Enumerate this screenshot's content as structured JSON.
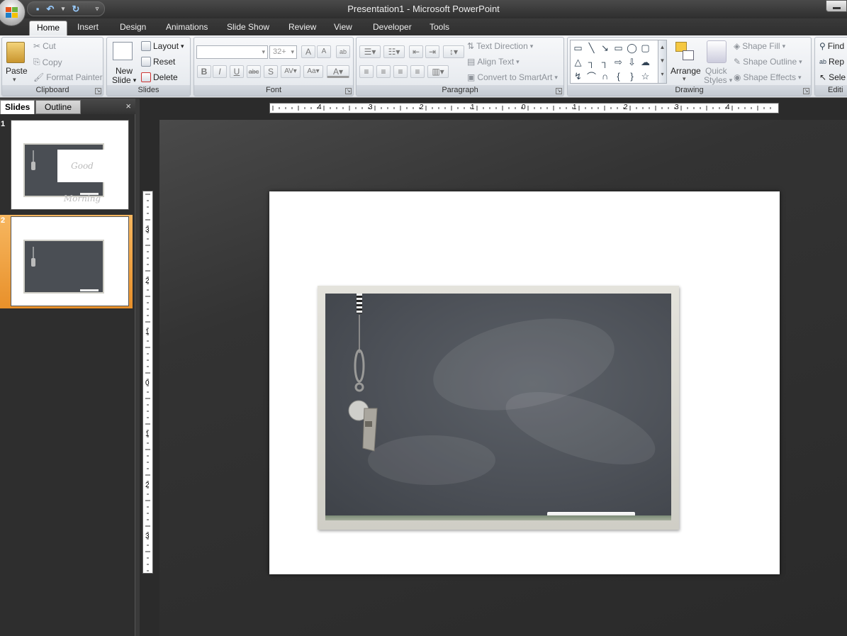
{
  "window": {
    "title": "Presentation1 - Microsoft PowerPoint"
  },
  "tabs": [
    "Home",
    "Insert",
    "Design",
    "Animations",
    "Slide Show",
    "Review",
    "View",
    "Developer",
    "Tools"
  ],
  "clipboard": {
    "paste": "Paste",
    "cut": "Cut",
    "copy": "Copy",
    "format_painter": "Format Painter",
    "label": "Clipboard"
  },
  "slides_group": {
    "new_slide_1": "New",
    "new_slide_2": "Slide",
    "layout": "Layout",
    "reset": "Reset",
    "delete": "Delete",
    "label": "Slides"
  },
  "font": {
    "size": "32+",
    "label": "Font"
  },
  "paragraph": {
    "text_direction": "Text Direction",
    "align_text": "Align Text",
    "convert": "Convert to SmartArt",
    "label": "Paragraph"
  },
  "drawing": {
    "arrange": "Arrange",
    "quick_styles_1": "Quick",
    "quick_styles_2": "Styles",
    "shape_fill": "Shape Fill",
    "shape_outline": "Shape Outline",
    "shape_effects": "Shape Effects",
    "label": "Drawing"
  },
  "editing": {
    "find": "Find",
    "replace": "Rep",
    "select": "Sele",
    "label": "Editi"
  },
  "pane": {
    "slides_tab": "Slides",
    "outline_tab": "Outline",
    "close": "×"
  },
  "thumbnails": [
    {
      "num": "1",
      "text": "Good Morning"
    },
    {
      "num": "2"
    }
  ],
  "ruler": {
    "h": [
      "4",
      "3",
      "2",
      "1",
      "0",
      "1",
      "2",
      "3",
      "4"
    ],
    "v": [
      "3",
      "2",
      "1",
      "0",
      "1",
      "2",
      "3"
    ]
  },
  "colors": {
    "selected_thumb": "#f0a040",
    "chalkboard": "#4e535a",
    "frame": "#d8d7cf"
  }
}
